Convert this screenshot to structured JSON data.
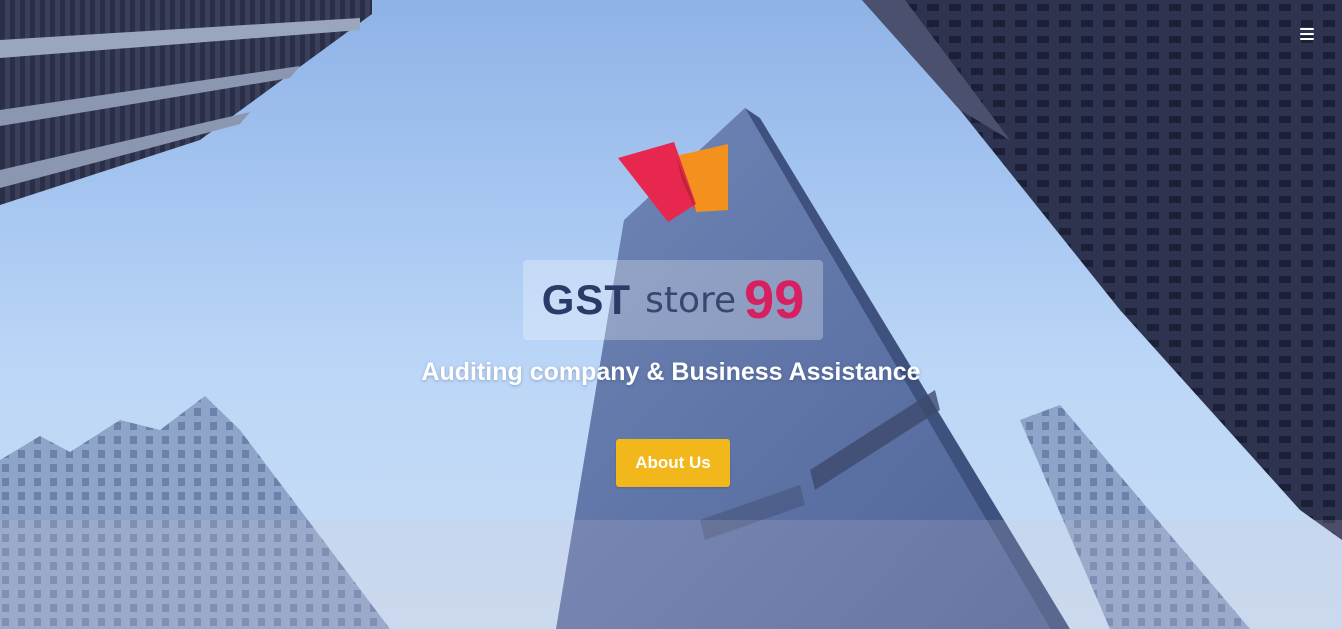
{
  "nav": {
    "menu_icon": "hamburger-menu-icon"
  },
  "logo": {
    "icon": "gst-store-99-logo-mark",
    "gst": "GST",
    "store": "store",
    "number": "99",
    "colors": {
      "gst": "#2b3a66",
      "store": "#3a4670",
      "number": "#d6205f",
      "red_panel": "#e8274f",
      "orange_panel": "#f4901e"
    }
  },
  "hero": {
    "tagline": "Auditing company & Business Assistance",
    "cta_label": "About Us",
    "cta_color": "#f2b71a"
  }
}
